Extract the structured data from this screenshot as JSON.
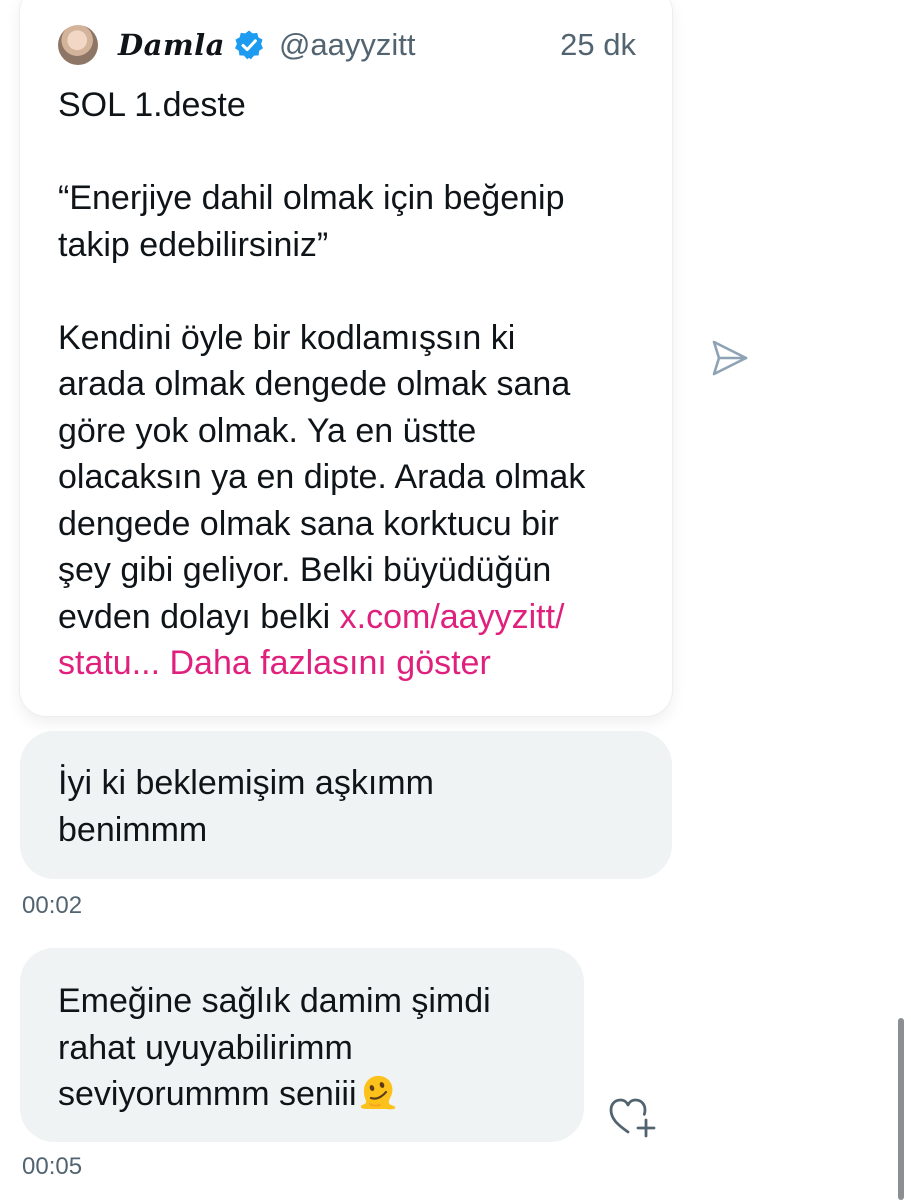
{
  "quoted_post": {
    "author_name": "𝑫𝒂𝒎𝒍𝒂",
    "author_handle": "@aayyzitt",
    "time_ago": "25 dk",
    "verified": true,
    "lines": [
      "SOL 1.deste",
      "",
      "“Enerjiye dahil olmak için beğenip",
      "takip edebilirsiniz”",
      "",
      "Kendini öyle bir kodlamışsın ki",
      "arada olmak dengede olmak sana",
      "göre yok olmak. Ya en üstte",
      "olacaksın ya en dipte. Arada olmak",
      "dengede olmak sana korktucu bir",
      "şey gibi geliyor. Belki büyüdüğün"
    ],
    "last_line_prefix": "evden dolayı belki ",
    "link_line_1": "x.com/aayyzitt/",
    "link_line_2": "statu... Daha fazlasını göster",
    "accent_color": "#e0207d"
  },
  "messages": [
    {
      "lines": [
        "İyi ki beklemişim aşkımm",
        "benimmm"
      ],
      "time": "00:02"
    },
    {
      "lines": [
        "Emeğine sağlık damim şimdi",
        "rahat uyuyabilirimm",
        "seviyorummm seniii"
      ],
      "emoji": "melting-face",
      "time": "00:05"
    }
  ],
  "icons": {
    "share": "paper-plane-icon",
    "react": "heart-plus-icon",
    "verified": "verified-badge-icon"
  }
}
